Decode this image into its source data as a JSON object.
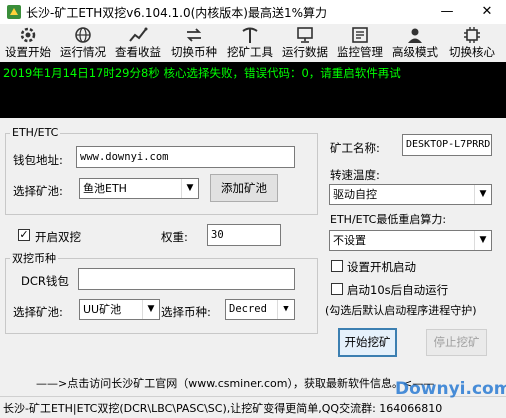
{
  "window": {
    "title": "长沙-矿工ETH双挖v6.104.1.0(内核版本)最高送1%算力",
    "minimize": "—",
    "close": "✕"
  },
  "toolbar": {
    "items": [
      {
        "label": "设置开始",
        "icon": "gear-icon"
      },
      {
        "label": "运行情况",
        "icon": "globe-icon"
      },
      {
        "label": "查看收益",
        "icon": "chart-icon"
      },
      {
        "label": "切换币种",
        "icon": "swap-icon"
      },
      {
        "label": "挖矿工具",
        "icon": "pickaxe-icon"
      },
      {
        "label": "运行数据",
        "icon": "monitor-icon"
      },
      {
        "label": "监控管理",
        "icon": "manage-icon"
      },
      {
        "label": "高级模式",
        "icon": "user-icon"
      },
      {
        "label": "切换核心",
        "icon": "core-icon"
      }
    ]
  },
  "console": {
    "line": "2019年1月14日17时29分8秒 核心选择失败，错误代码：0，请重启软件再试"
  },
  "eth_group": {
    "legend": "ETH/ETC",
    "wallet_label": "钱包地址:",
    "wallet_value": "www.downyi.com",
    "pool_label": "选择矿池:",
    "pool_value": "鱼池ETH",
    "add_pool_button": "添加矿池"
  },
  "dual": {
    "enable_label": "开启双挖",
    "enable_checked": true,
    "weight_label": "权重:",
    "weight_value": "30"
  },
  "dual_group": {
    "legend": "双挖币种",
    "wallet_label": "DCR钱包",
    "wallet_value": "",
    "pool_label": "选择矿池:",
    "pool_value": "UU矿池",
    "coin_label": "选择币种:",
    "coin_value": "Decred"
  },
  "right_panel": {
    "miner_name_label": "矿工名称:",
    "miner_name_value": "DESKTOP-L7PRRD",
    "fan_label": "转速温度:",
    "fan_value": "驱动自控",
    "min_hashrate_label": "ETH/ETC最低重启算力:",
    "min_hashrate_value": "不设置",
    "autostart_label": "设置开机启动",
    "autostart_checked": false,
    "autorun_label": "启动10s后自动运行",
    "autorun_checked": false,
    "guard_note": "(勾选后默认启动程序进程守护)",
    "start_button": "开始挖矿",
    "stop_button": "停止挖矿"
  },
  "link_text": "——>点击访问长沙矿工官网（www.csminer.com），获取最新软件信息。<——",
  "status_text": "长沙-矿工ETH|ETC双挖(DCR\\LBC\\PASC\\SC),让挖矿变得更简单,QQ交流群: 164066810",
  "watermark": "Downyi.com",
  "colors": {
    "console_bg": "#000000",
    "console_text": "#00ff00",
    "watermark": "#2a7bd3"
  }
}
